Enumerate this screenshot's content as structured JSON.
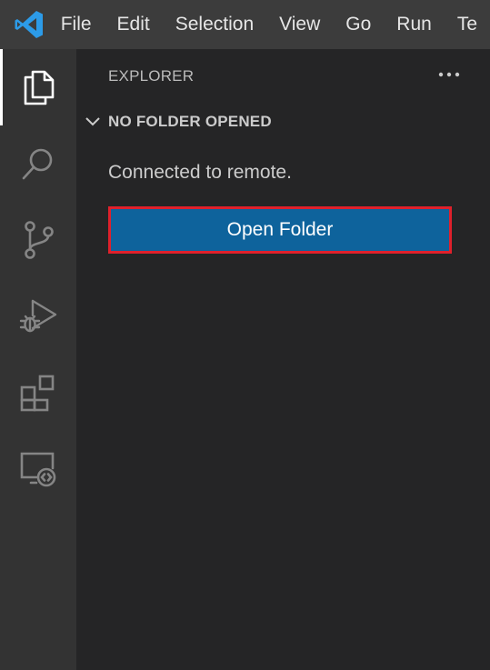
{
  "app": {
    "logo_icon": "vscode-logo-icon",
    "brand_color": "#2c9be8"
  },
  "menubar": {
    "items": [
      "File",
      "Edit",
      "Selection",
      "View",
      "Go",
      "Run",
      "Te"
    ]
  },
  "activitybar": {
    "items": [
      {
        "icon": "explorer-icon",
        "active": true
      },
      {
        "icon": "search-icon",
        "active": false
      },
      {
        "icon": "source-control-icon",
        "active": false
      },
      {
        "icon": "run-debug-icon",
        "active": false
      },
      {
        "icon": "extensions-icon",
        "active": false
      },
      {
        "icon": "remote-explorer-icon",
        "active": false
      }
    ]
  },
  "sidebar": {
    "title": "EXPLORER",
    "more_icon": "ellipsis-icon",
    "section": {
      "chevron_icon": "chevron-down-icon",
      "label": "NO FOLDER OPENED"
    },
    "message": "Connected to remote.",
    "open_folder_label": "Open Folder"
  },
  "colors": {
    "titlebar_bg": "#3c3c3c",
    "activitybar_bg": "#333333",
    "sidebar_bg": "#252526",
    "button_bg": "#0e639c",
    "highlight_border": "#e0202b"
  }
}
